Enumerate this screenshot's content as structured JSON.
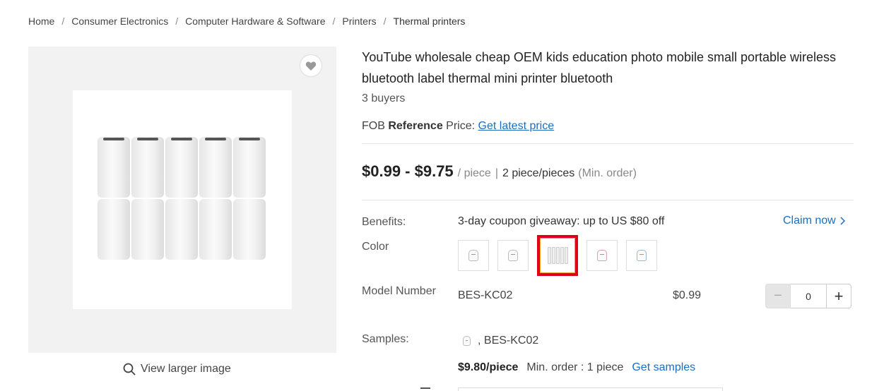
{
  "breadcrumb": {
    "items": [
      "Home",
      "Consumer Electronics",
      "Computer Hardware & Software",
      "Printers"
    ],
    "current": "Thermal printers"
  },
  "gallery": {
    "view_larger": "View larger image",
    "favorite_icon": "heart-icon",
    "search_icon": "magnifier-icon"
  },
  "product": {
    "title": "YouTube wholesale cheap OEM kids education photo mobile small portable wireless bluetooth label thermal mini printer bluetooth",
    "buyers": "3 buyers",
    "fob": {
      "prefix": "FOB",
      "bold": "Reference",
      "suffix": "Price:",
      "link": "Get latest price"
    },
    "price": {
      "range": "$0.99 - $9.75",
      "unit": "/ piece",
      "separator": "|",
      "min_qty": "2 piece/pieces",
      "min_label": "(Min. order)"
    }
  },
  "benefits": {
    "label": "Benefits:",
    "text": "3-day coupon giveaway: up to US $80 off",
    "claim": "Claim now",
    "claim_icon": "chevron-right-icon"
  },
  "color": {
    "label": "Color",
    "swatches": [
      "printer-white-1",
      "printer-white-2",
      "paper-rolls",
      "printer-pink",
      "printer-blue"
    ],
    "selected_index": 2,
    "selected_color": "#e0001b"
  },
  "model": {
    "label": "Model Number",
    "value": "BES-KC02",
    "price": "$0.99",
    "quantity": "0",
    "minus": "−",
    "plus": "+"
  },
  "samples": {
    "label": "Samples:",
    "item": ", BES-KC02",
    "price": "$9.80/piece",
    "min_order": "Min. order : 1 piece",
    "link": "Get samples"
  },
  "colors": {
    "link": "#1a6fbf",
    "selected_border": "#e0001b"
  }
}
